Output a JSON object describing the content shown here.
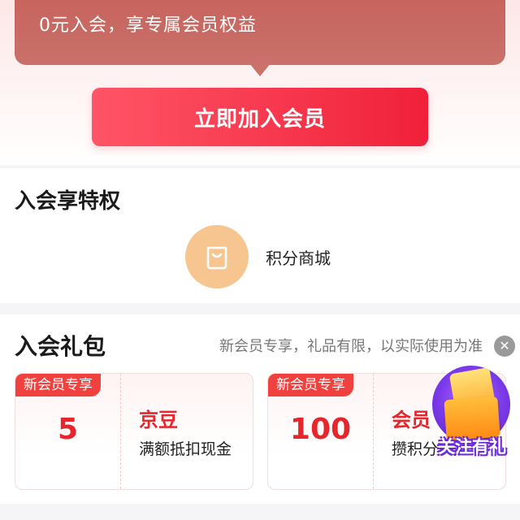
{
  "banner": {
    "text": "0元入会，享专属会员权益"
  },
  "join_button": {
    "label": "立即加入会员"
  },
  "privileges": {
    "title": "入会享特权",
    "items": [
      {
        "label": "积分商城",
        "icon": "shopping-bag-icon"
      }
    ]
  },
  "gift": {
    "title": "入会礼包",
    "note": "新会员专享，礼品有限，以实际使用为准",
    "close_icon": "close-icon",
    "coupons": [
      {
        "tag": "新会员专享",
        "amount": "5",
        "name": "京豆",
        "desc": "满额抵扣现金"
      },
      {
        "tag": "新会员专享",
        "amount": "100",
        "name": "会员",
        "desc": "攒积分"
      }
    ]
  },
  "follow_widget": {
    "label": "关注有礼"
  },
  "colors": {
    "accent_red": "#f0203a",
    "banner_red": "#c8645e",
    "icon_orange": "#f7c58f",
    "widget_purple": "#7c3bea"
  }
}
